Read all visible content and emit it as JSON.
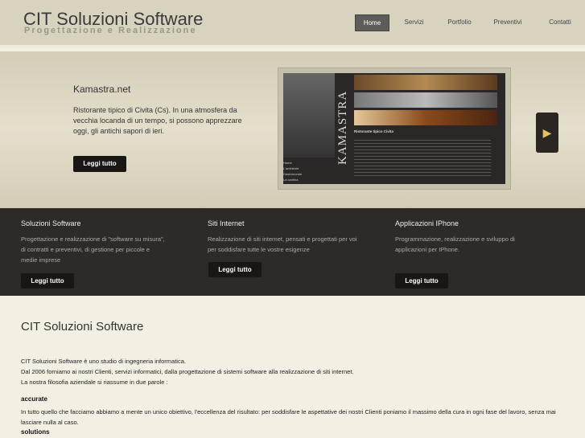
{
  "header": {
    "title": "CIT Soluzioni Software",
    "tagline": "Progettazione e Realizzazione",
    "nav": [
      "Home",
      "Servizi",
      "Portfolio",
      "Preventivi",
      "Contatti"
    ]
  },
  "hero": {
    "title": "Kamastra.net",
    "text": "Ristorante tipico di Civita (Cs). In una atmosfera da vecchia locanda di un tempo, si possono apprezzare oggi, gli antichi sapori di ieri.",
    "button": "Leggi tutto",
    "preview_brand": "KAMASTRA",
    "preview_menu": [
      "Home",
      "L'ambiente",
      "Gastronomia",
      "La cantina"
    ],
    "preview_heading": "Ristorante tipico Civita"
  },
  "services": [
    {
      "title": "Soluzioni Software",
      "text": "Progettazione e realizzazione di \"software su misura\", di contratti e preventivi, di gestione per piccole e medie imprese",
      "button": "Leggi tutto"
    },
    {
      "title": "Siti Internet",
      "text": "Realizzazione di siti internet, pensati e progettati per voi per soddisfare tutte le vostre esigenze",
      "button": "Leggi tutto"
    },
    {
      "title": "Applicazioni IPhone",
      "text": "Programmazione, realizzazione e sviluppo di applicazioni per IPhone.",
      "button": "Leggi tutto"
    }
  ],
  "main": {
    "title": "CIT Soluzioni Software",
    "lines": [
      "CIT Soluzioni Software è uno studio di ingegneria informatica.",
      "Dal 2006 forniamo ai nostri Clienti, servizi informatici, dalla progettazione di sistemi software alla realizzazione di siti internet.",
      "La nostra filosofia aziendale si riassume in due parole :"
    ],
    "h_accurate": "accurate",
    "accurate_text": "In tutto quello che facciamo abbiamo a mente un unico obiettivo, l'eccellenza del risultato: per soddisfare le aspettative dei nostri Clienti poniamo il massimo della cura in ogni fase del lavoro, senza mai lasciare nulla al caso.",
    "h_solutions": "solutions"
  }
}
